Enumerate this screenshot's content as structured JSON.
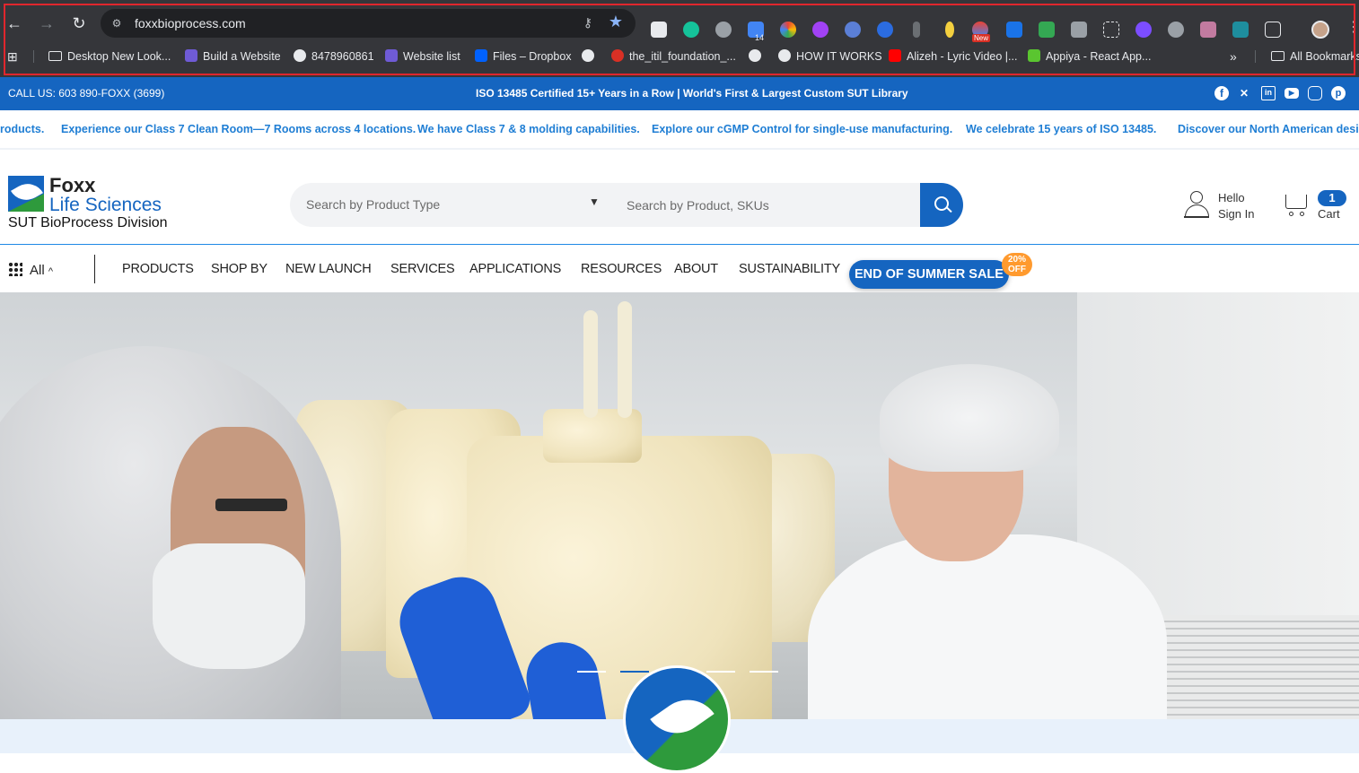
{
  "browser": {
    "url": "foxxbioprocess.com",
    "ext_badge_count": "14",
    "ext_new_label": "New",
    "bookmarks": [
      {
        "label": "Desktop New Look...",
        "icon": "folder-icon"
      },
      {
        "label": "Build a Website",
        "icon": "bookmark-icon"
      },
      {
        "label": "8478960861",
        "icon": "globe-icon"
      },
      {
        "label": "Website list",
        "icon": "bookmark-icon"
      },
      {
        "label": "Files – Dropbox",
        "icon": "dropbox-icon"
      },
      {
        "label": "",
        "icon": "globe-icon"
      },
      {
        "label": "the_itil_foundation_...",
        "icon": "bookmark-icon"
      },
      {
        "label": "",
        "icon": "globe-icon"
      },
      {
        "label": "HOW IT WORKS",
        "icon": "globe-icon"
      },
      {
        "label": "Alizeh - Lyric Video |...",
        "icon": "youtube-icon"
      },
      {
        "label": "Appiya - React App...",
        "icon": "app-icon"
      }
    ],
    "overflow": "»",
    "all_bookmarks": "All Bookmarks"
  },
  "topbar": {
    "call": "CALL US: 603 890-FOXX (3699)",
    "iso": "ISO 13485 Certified 15+ Years in a Row | World's First & Largest Custom SUT Library",
    "social": [
      "facebook-icon",
      "x-icon",
      "linkedin-icon",
      "youtube-icon",
      "instagram-icon",
      "pinterest-icon"
    ]
  },
  "ticker": [
    "roducts.",
    "Experience our Class 7 Clean Room—7 Rooms across 4 locations.",
    "We have Class 7 & 8 molding capabilities.",
    "Explore our cGMP Control for single-use manufacturing.",
    "We celebrate 15 years of ISO 13485.",
    "Discover our North American desig"
  ],
  "header": {
    "logo_foxx": "Foxx",
    "logo_life": "Life Sciences",
    "logo_division": "SUT BioProcess Division",
    "search_type_placeholder": "Search by Product Type",
    "search_placeholder": "Search by Product, SKUs",
    "hello": "Hello",
    "sign_in": "Sign In",
    "cart_count": "1",
    "cart_label": "Cart"
  },
  "nav": {
    "all": "All",
    "items": [
      "PRODUCTS",
      "SHOP BY",
      "NEW LAUNCH",
      "SERVICES",
      "APPLICATIONS",
      "RESOURCES",
      "ABOUT",
      "SUSTAINABILITY"
    ],
    "sale": "END OF SUMMER SALE",
    "off_pct": "20%",
    "off_word": "OFF"
  },
  "hero": {
    "slides": 5,
    "active_slide": 2
  },
  "colors": {
    "brand_blue": "#1565c0",
    "brand_green": "#2e9a3c",
    "sale_badge": "#ff9a2e"
  }
}
